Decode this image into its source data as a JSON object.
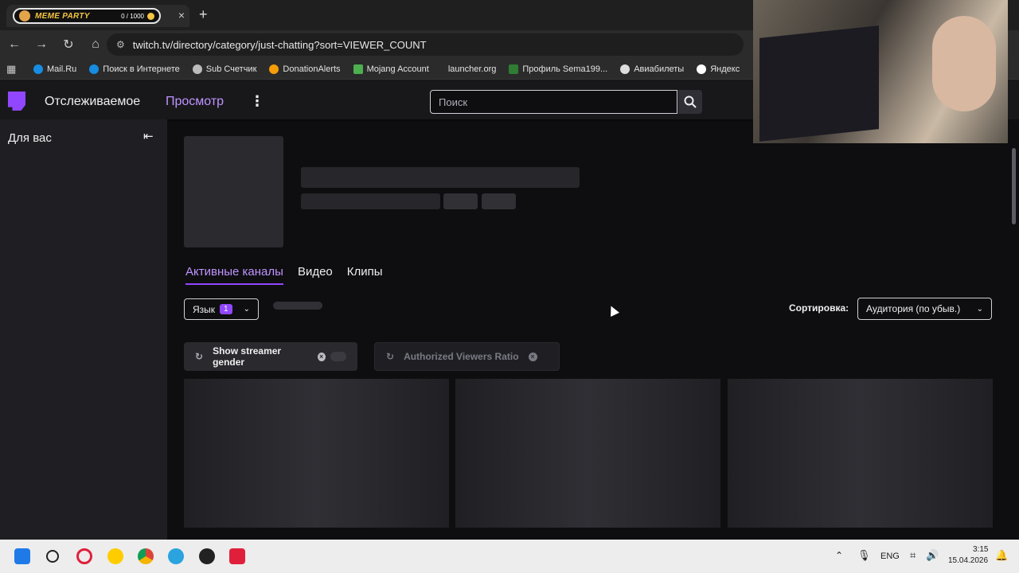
{
  "browser": {
    "tab": {
      "widget_label": "MEME PARTY",
      "widget_count": "0 / 1000",
      "close_icon": "×",
      "new_tab_icon": "+"
    },
    "url": "twitch.tv/directory/category/just-chatting?sort=VIEWER_COUNT",
    "bookmarks": [
      {
        "label": "Mail.Ru",
        "color": "#168de2"
      },
      {
        "label": "Поиск в Интернете",
        "color": "#168de2"
      },
      {
        "label": "Sub Счетчик",
        "color": "#bbbbbb"
      },
      {
        "label": "DonationAlerts",
        "color": "#f59c07"
      },
      {
        "label": "Mojang Account",
        "color": "#4caf50"
      },
      {
        "label": "launcher.org",
        "color": "#2b2b2b"
      },
      {
        "label": "Профиль Sema199...",
        "color": "#2e7d32"
      },
      {
        "label": "Авиабилеты",
        "color": "#dddddd"
      },
      {
        "label": "Яндекс",
        "color": "#ffffff"
      }
    ]
  },
  "twitch": {
    "nav_following": "Отслеживаемое",
    "nav_browse": "Просмотр",
    "more_icon": "⋮",
    "search_placeholder": "Поиск",
    "sidebar_title": "Для вас",
    "collapse_icon": "⇤",
    "tabs": [
      "Активные каналы",
      "Видео",
      "Клипы"
    ],
    "language_label": "Язык",
    "language_count": "1",
    "sort_label": "Сортировка:",
    "sort_value": "Аудитория (по убыв.)",
    "ext_pill_1": "Show streamer gender",
    "ext_pill_2": "Authorized Viewers Ratio",
    "accent": "#9147ff"
  },
  "taskbar": {
    "lang": "ENG",
    "time": "3:15",
    "date": "15.04.2026"
  }
}
